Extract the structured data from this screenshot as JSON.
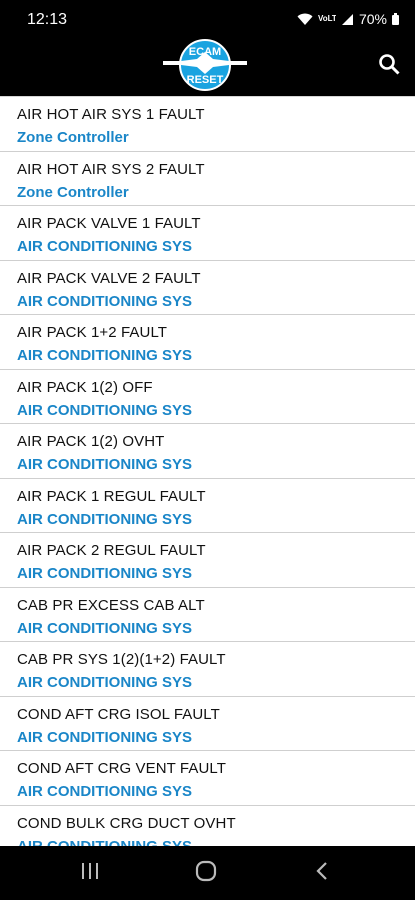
{
  "status_bar": {
    "time": "12:13",
    "battery": "70%",
    "network": "VoLTE"
  },
  "app_bar": {
    "logo_text_top": "ECAM",
    "logo_text_bottom": "RESET",
    "logo_color": "#1aa3e0"
  },
  "colors": {
    "subtitle": "#1a86c8"
  },
  "items": [
    {
      "title": "AIR HOT AIR SYS 1 FAULT",
      "subtitle": "Zone Controller"
    },
    {
      "title": "AIR HOT AIR SYS 2 FAULT",
      "subtitle": "Zone Controller"
    },
    {
      "title": "AIR PACK VALVE 1 FAULT",
      "subtitle": "AIR CONDITIONING SYS"
    },
    {
      "title": "AIR PACK VALVE 2 FAULT",
      "subtitle": "AIR CONDITIONING SYS"
    },
    {
      "title": "AIR PACK 1+2 FAULT",
      "subtitle": "AIR CONDITIONING SYS"
    },
    {
      "title": "AIR PACK 1(2) OFF",
      "subtitle": "AIR CONDITIONING SYS"
    },
    {
      "title": "AIR PACK 1(2) OVHT",
      "subtitle": "AIR CONDITIONING SYS"
    },
    {
      "title": "AIR PACK 1 REGUL FAULT",
      "subtitle": "AIR CONDITIONING SYS"
    },
    {
      "title": "AIR PACK 2 REGUL FAULT",
      "subtitle": "AIR CONDITIONING SYS"
    },
    {
      "title": "CAB PR EXCESS CAB ALT",
      "subtitle": "AIR CONDITIONING SYS"
    },
    {
      "title": "CAB PR SYS 1(2)(1+2) FAULT",
      "subtitle": "AIR CONDITIONING SYS"
    },
    {
      "title": "COND AFT CRG ISOL FAULT",
      "subtitle": "AIR CONDITIONING SYS"
    },
    {
      "title": "COND AFT CRG VENT FAULT",
      "subtitle": "AIR CONDITIONING SYS"
    },
    {
      "title": "COND BULK CRG DUCT OVHT",
      "subtitle": "AIR CONDITIONING SYS"
    }
  ]
}
